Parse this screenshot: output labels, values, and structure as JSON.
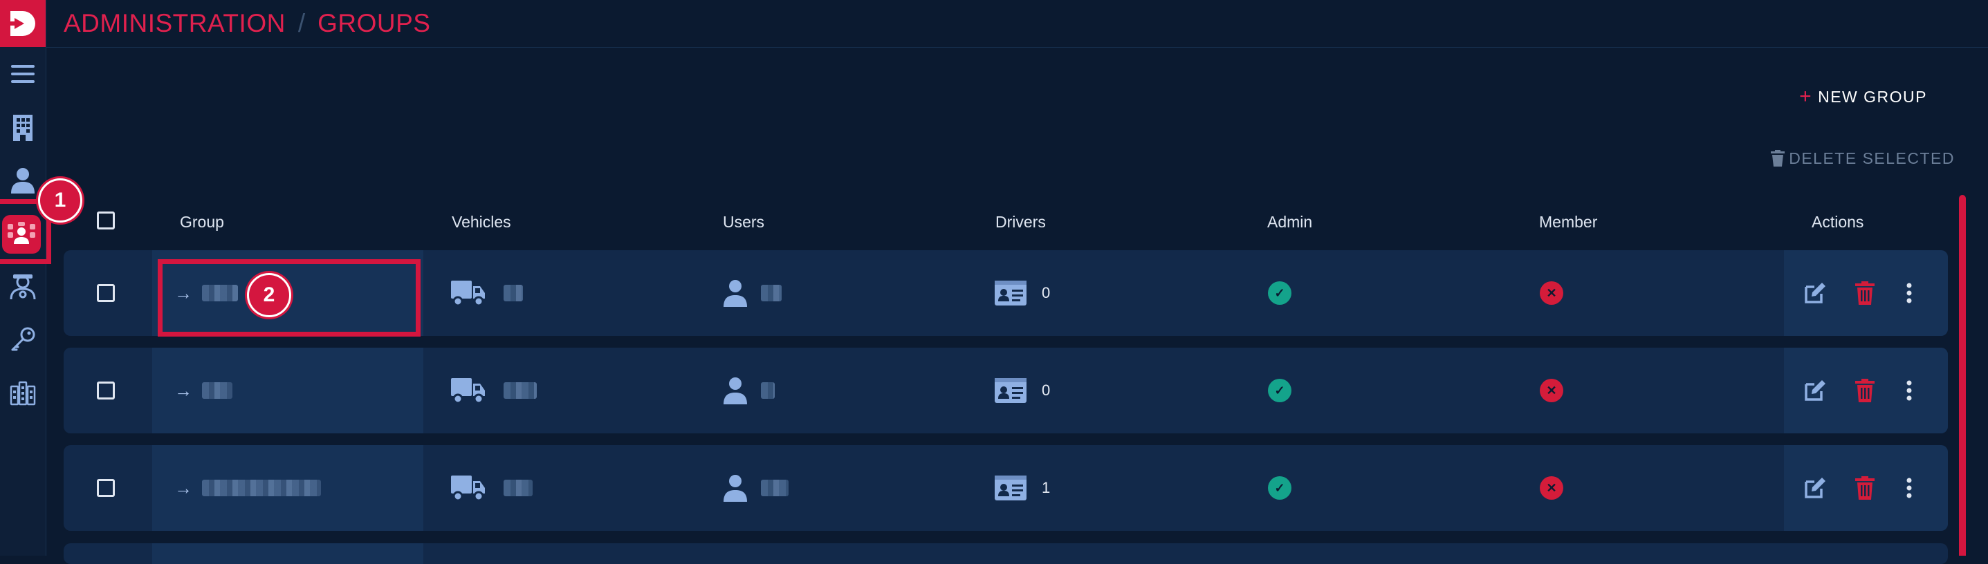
{
  "header": {
    "breadcrumb": [
      "ADMINISTRATION",
      "GROUPS"
    ],
    "separator": "/"
  },
  "toolbar": {
    "new_label": "NEW GROUP",
    "new_icon": "plus-icon",
    "delete_label": "DELETE SELECTED",
    "delete_icon": "trash-icon"
  },
  "sidebar": {
    "items": [
      {
        "icon": "menu-icon"
      },
      {
        "icon": "building-icon"
      },
      {
        "icon": "user-icon"
      },
      {
        "icon": "groups-icon",
        "active": true
      },
      {
        "icon": "driver-icon"
      },
      {
        "icon": "key-icon"
      },
      {
        "icon": "dashboard-icon"
      }
    ]
  },
  "annotations": {
    "marker1": "1",
    "marker2": "2"
  },
  "table": {
    "columns": [
      "Group",
      "Vehicles",
      "Users",
      "Drivers",
      "Admin",
      "Member",
      "Actions"
    ],
    "rows": [
      {
        "drivers": "0",
        "admin": true,
        "member": false
      },
      {
        "drivers": "0",
        "admin": true,
        "member": false
      },
      {
        "drivers": "1",
        "admin": true,
        "member": false
      }
    ]
  },
  "colors": {
    "accent": "#d4163f",
    "background": "#0b1a30",
    "row": "#12294a",
    "success": "#14a38b",
    "danger": "#d41c3a"
  }
}
